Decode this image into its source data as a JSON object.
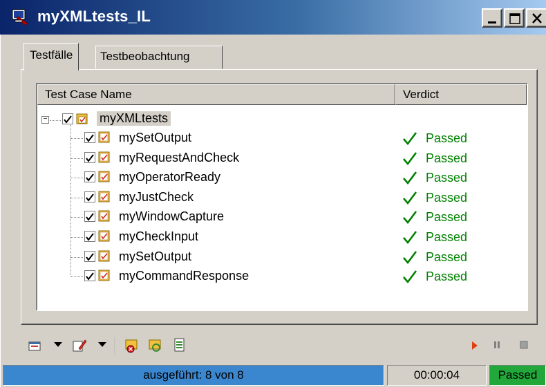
{
  "window": {
    "title": "myXMLtests_IL"
  },
  "tabs": [
    {
      "label": "Testfälle",
      "active": true
    },
    {
      "label": "Testbeobachtung",
      "active": false
    }
  ],
  "grid": {
    "columns": [
      "Test Case Name",
      "Verdict"
    ],
    "root": {
      "label": "myXMLtests"
    },
    "rows": [
      {
        "name": "mySetOutput",
        "verdict": "Passed"
      },
      {
        "name": "myRequestAndCheck",
        "verdict": "Passed"
      },
      {
        "name": "myOperatorReady",
        "verdict": "Passed"
      },
      {
        "name": "myJustCheck",
        "verdict": "Passed"
      },
      {
        "name": "myWindowCapture",
        "verdict": "Passed"
      },
      {
        "name": "myCheckInput",
        "verdict": "Passed"
      },
      {
        "name": "mySetOutput",
        "verdict": "Passed"
      },
      {
        "name": "myCommandResponse",
        "verdict": "Passed"
      }
    ]
  },
  "status": {
    "progress_text": "ausgeführt: 8 von 8",
    "progress_fraction": 1.0,
    "elapsed": "00:00:04",
    "verdict": "Passed"
  },
  "colors": {
    "passed": "#008000",
    "status_verdict_bg": "#22a83a",
    "progress_bg": "#3a87d0"
  },
  "icons": {
    "toolbar": [
      "open-icon",
      "dropdown-arrow-icon",
      "edit-icon",
      "dropdown-arrow-icon",
      "stop-record-icon",
      "refresh-icon",
      "report-icon",
      "play-icon",
      "pause-icon",
      "stop-icon"
    ]
  }
}
